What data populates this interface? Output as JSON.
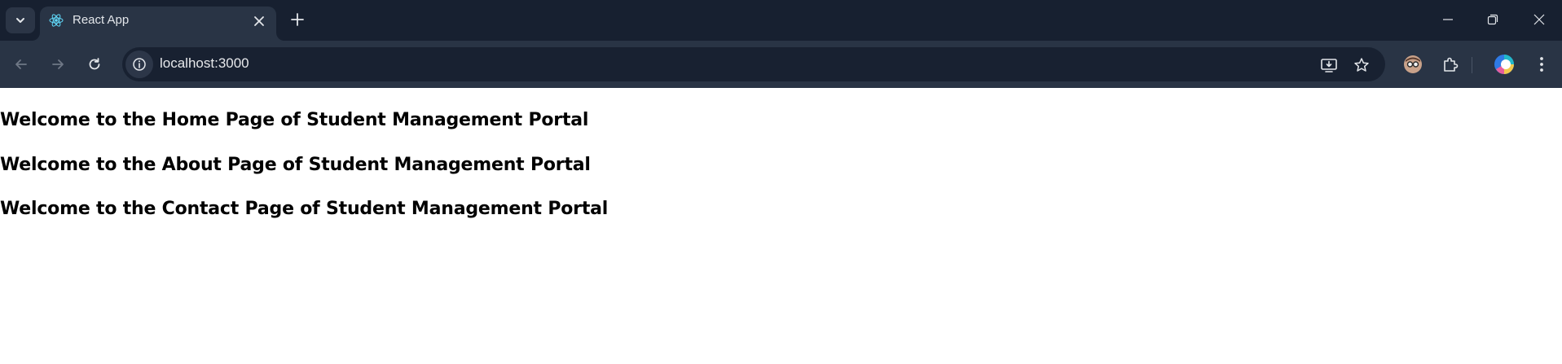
{
  "browser": {
    "tab": {
      "title": "React App"
    },
    "address_bar": {
      "url": "localhost:3000"
    }
  },
  "icons": {
    "tab_search": "chevron-down-icon",
    "favicon": "react-logo-icon",
    "tab_close": "close-icon",
    "new_tab": "plus-icon",
    "minimize": "minimize-icon",
    "restore": "restore-icon",
    "window_close": "close-icon",
    "back": "arrow-left-icon",
    "forward": "arrow-right-icon",
    "reload": "reload-icon",
    "site_info": "info-icon",
    "install": "install-app-icon",
    "bookmark": "star-icon",
    "profile": "avatar-icon",
    "extensions": "puzzle-icon",
    "copilot": "copilot-icon",
    "menu": "kebab-menu-icon"
  },
  "colors": {
    "tabstrip_bg": "#172030",
    "toolbar_bg": "#293445",
    "omnibox_bg": "#182131",
    "page_bg": "#ffffff",
    "text_dark": "#000000"
  },
  "page": {
    "headings": [
      "Welcome to the Home Page of Student Management Portal",
      "Welcome to the About Page of Student Management Portal",
      "Welcome to the Contact Page of Student Management Portal"
    ]
  }
}
